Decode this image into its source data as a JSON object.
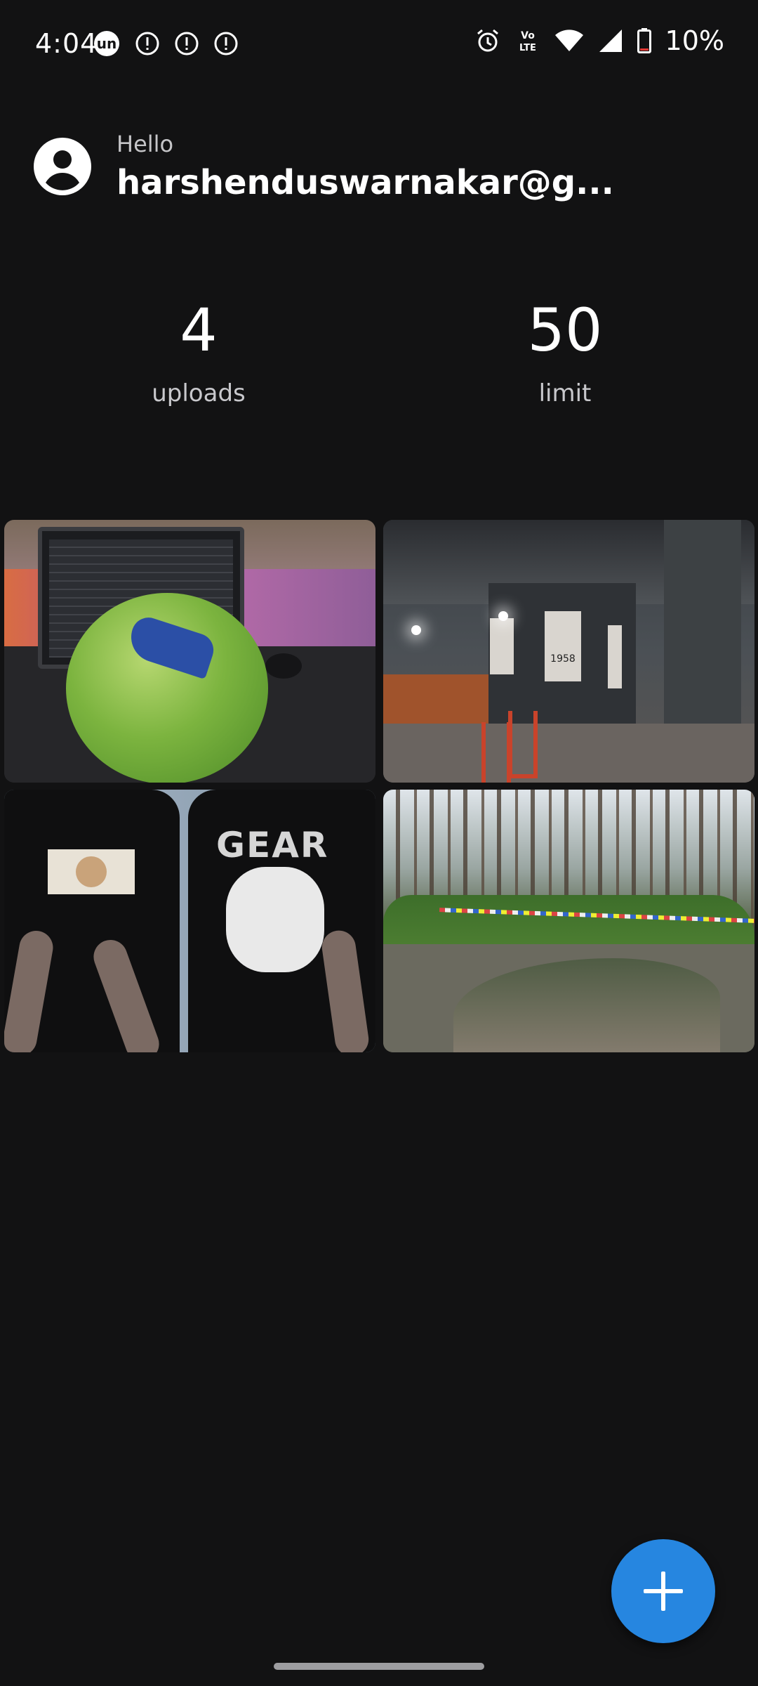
{
  "status_bar": {
    "time": "4:04",
    "battery_text": "10%",
    "left_icons": [
      "un-app-icon",
      "alert-icon",
      "alert-icon",
      "alert-icon"
    ],
    "right_icons": [
      "alarm-icon",
      "volte-icon",
      "wifi-icon",
      "signal-icon",
      "battery-low-icon"
    ],
    "volte_label": "Vo LTE"
  },
  "header": {
    "greeting": "Hello",
    "user": "harshenduswarnakar@g..."
  },
  "stats": {
    "uploads_value": "4",
    "uploads_label": "uploads",
    "limit_value": "50",
    "limit_label": "limit"
  },
  "gallery": {
    "items": [
      {
        "subject": "football-laptop"
      },
      {
        "subject": "restaurant-interior"
      },
      {
        "subject": "tshirts"
      },
      {
        "subject": "forest-pond"
      }
    ],
    "poster_text": "1958",
    "shirt_text": "GEAR"
  },
  "fab": {
    "icon": "plus-icon",
    "color": "#2686e0"
  }
}
